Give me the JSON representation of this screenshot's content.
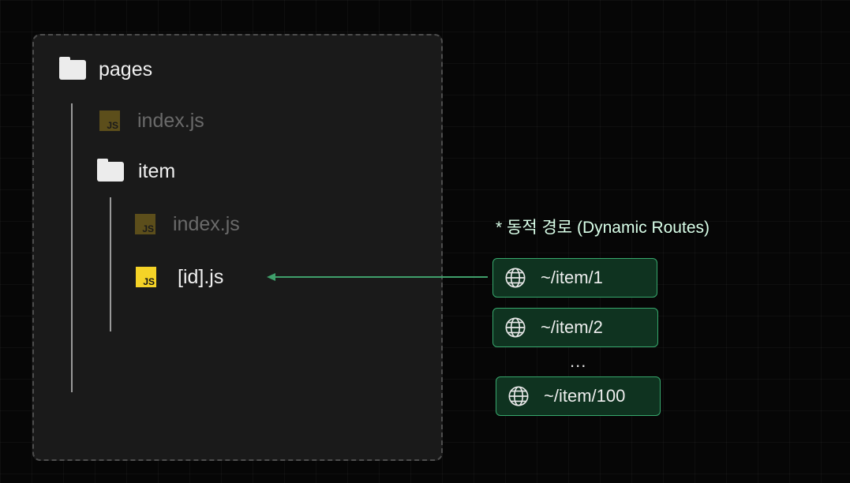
{
  "tree": {
    "root_label": "pages",
    "root_index_label": "index.js",
    "subfolder_label": "item",
    "item_index_label": "index.js",
    "dynamic_file_label": "[id].js",
    "js_badge": "JS"
  },
  "dynamic_routes": {
    "caption": "* 동적 경로 (Dynamic Routes)",
    "routes": [
      "~/item/1",
      "~/item/2",
      "~/item/100"
    ],
    "ellipsis": "..."
  },
  "colors": {
    "accent_green": "#37a86d",
    "js_yellow": "#f5d327",
    "js_dim": "#5c4e1b"
  },
  "icons": [
    "folder-icon",
    "js-file-icon",
    "globe-icon",
    "arrow-left-icon"
  ]
}
